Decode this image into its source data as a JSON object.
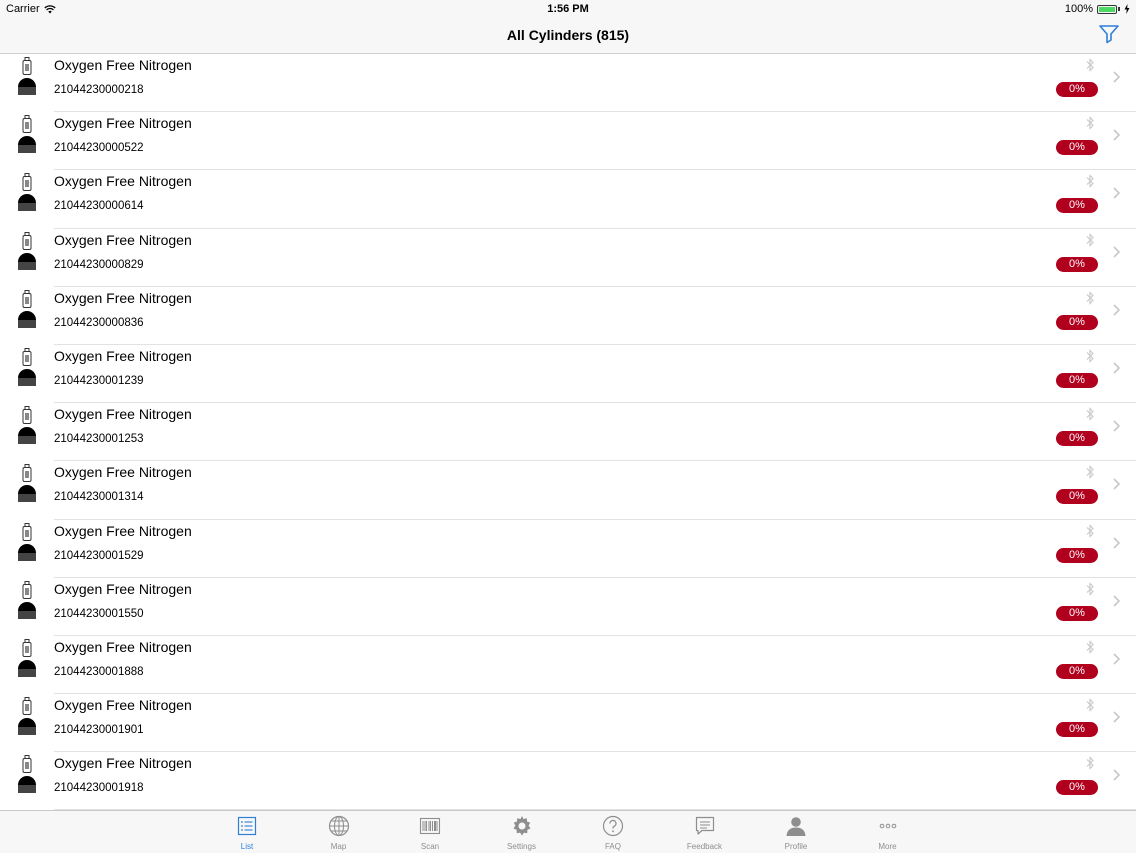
{
  "status_bar": {
    "carrier": "Carrier",
    "time": "1:56 PM",
    "battery": "100%",
    "battery_level": 1.0
  },
  "nav": {
    "title": "All Cylinders (815)",
    "filter_icon": "filter-icon"
  },
  "colors": {
    "badge": "#b0001e",
    "accent": "#2f7fd8"
  },
  "cylinders": [
    {
      "name": "Oxygen Free Nitrogen",
      "serial": "21044230000218",
      "level": "0%"
    },
    {
      "name": "Oxygen Free Nitrogen",
      "serial": "21044230000522",
      "level": "0%"
    },
    {
      "name": "Oxygen Free Nitrogen",
      "serial": "21044230000614",
      "level": "0%"
    },
    {
      "name": "Oxygen Free Nitrogen",
      "serial": "21044230000829",
      "level": "0%"
    },
    {
      "name": "Oxygen Free Nitrogen",
      "serial": "21044230000836",
      "level": "0%"
    },
    {
      "name": "Oxygen Free Nitrogen",
      "serial": "21044230001239",
      "level": "0%"
    },
    {
      "name": "Oxygen Free Nitrogen",
      "serial": "21044230001253",
      "level": "0%"
    },
    {
      "name": "Oxygen Free Nitrogen",
      "serial": "21044230001314",
      "level": "0%"
    },
    {
      "name": "Oxygen Free Nitrogen",
      "serial": "21044230001529",
      "level": "0%"
    },
    {
      "name": "Oxygen Free Nitrogen",
      "serial": "21044230001550",
      "level": "0%"
    },
    {
      "name": "Oxygen Free Nitrogen",
      "serial": "21044230001888",
      "level": "0%"
    },
    {
      "name": "Oxygen Free Nitrogen",
      "serial": "21044230001901",
      "level": "0%"
    },
    {
      "name": "Oxygen Free Nitrogen",
      "serial": "21044230001918",
      "level": "0%"
    }
  ],
  "tabs": [
    {
      "label": "List",
      "icon": "list-icon",
      "active": true
    },
    {
      "label": "Map",
      "icon": "globe-icon",
      "active": false
    },
    {
      "label": "Scan",
      "icon": "barcode-icon",
      "active": false
    },
    {
      "label": "Settings",
      "icon": "gear-icon",
      "active": false
    },
    {
      "label": "FAQ",
      "icon": "question-icon",
      "active": false
    },
    {
      "label": "Feedback",
      "icon": "chat-icon",
      "active": false
    },
    {
      "label": "Profile",
      "icon": "person-icon",
      "active": false
    },
    {
      "label": "More",
      "icon": "more-icon",
      "active": false
    }
  ]
}
